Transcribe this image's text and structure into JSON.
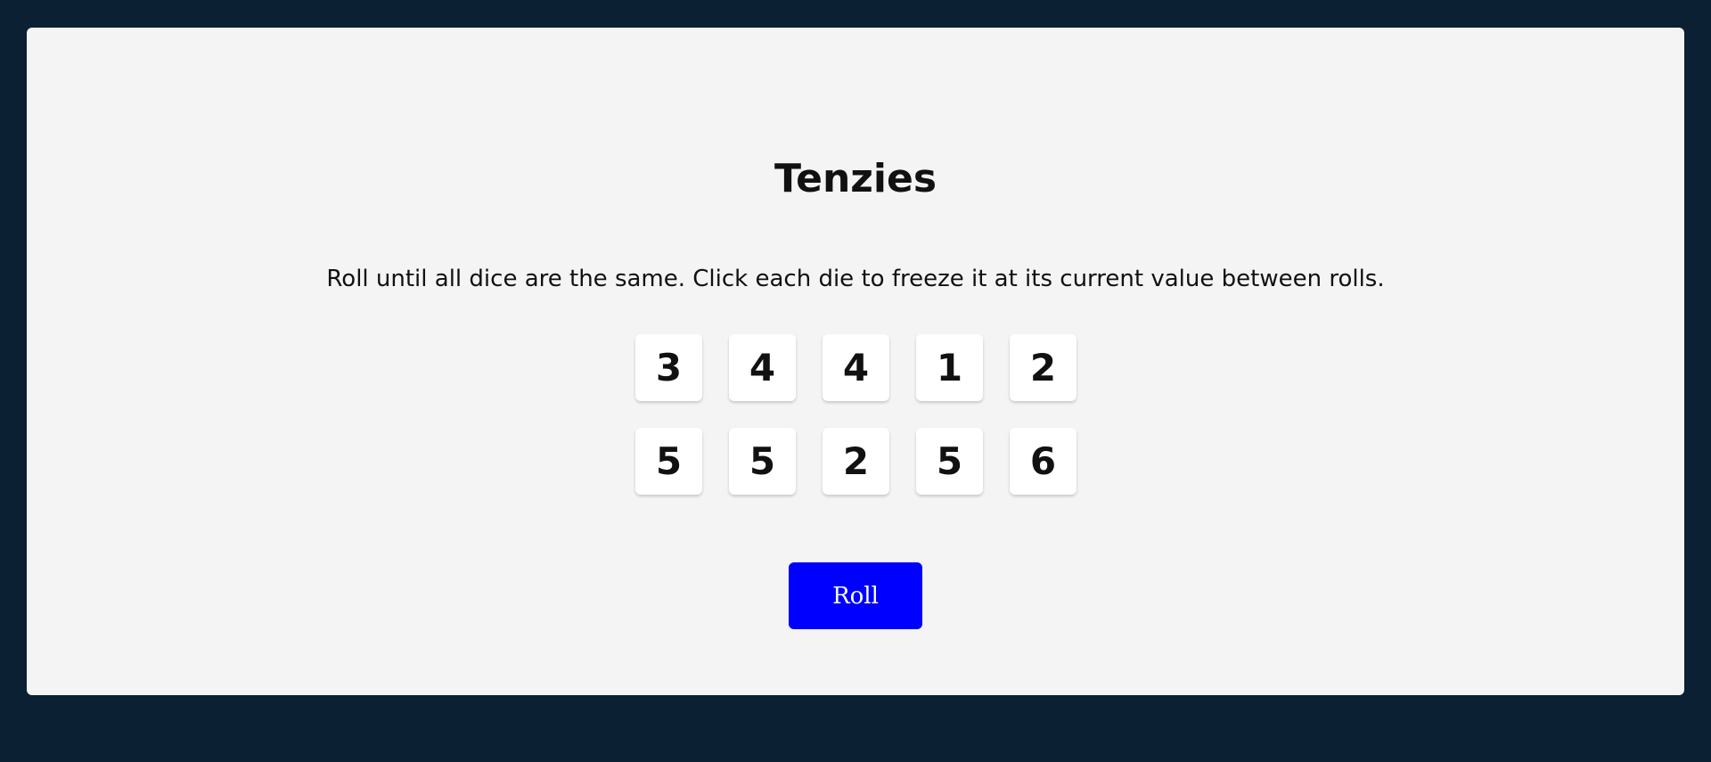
{
  "title": "Tenzies",
  "instructions": "Roll until all dice are the same. Click each die to freeze it at its current value between rolls.",
  "dice": [
    "3",
    "4",
    "4",
    "1",
    "2",
    "5",
    "5",
    "2",
    "5",
    "6"
  ],
  "roll_button_label": "Roll",
  "colors": {
    "page_background": "#0b2033",
    "board_background": "#f4f4f4",
    "die_background": "#ffffff",
    "roll_button_background": "#0000ff",
    "roll_button_text": "#ffffff"
  }
}
